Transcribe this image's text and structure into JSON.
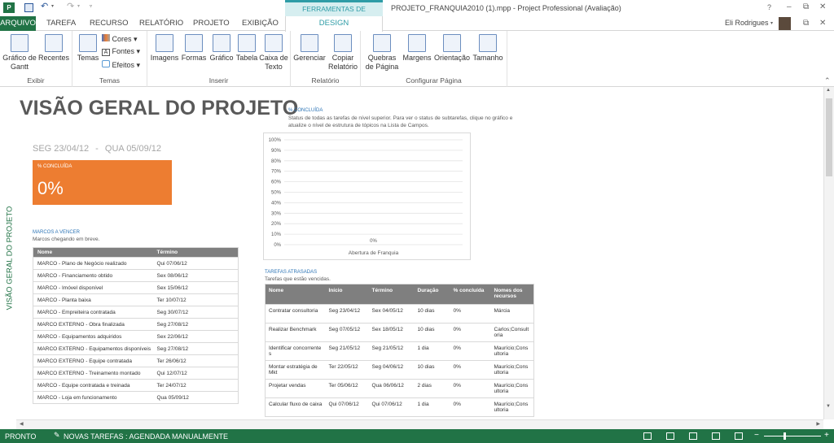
{
  "titlebar": {
    "context_tab": "FERRAMENTAS DE RELATÓRIO",
    "title": "PROJETO_FRANQUIA2010 (1).mpp - Project Professional (Avaliação)",
    "help": "?",
    "min": "–",
    "restore": "⧉",
    "close": "✕"
  },
  "tabs": [
    "ARQUIVO",
    "TAREFA",
    "RECURSO",
    "RELATÓRIO",
    "PROJETO",
    "EXIBIÇÃO",
    "DESIGN"
  ],
  "user": {
    "name": "Eli Rodrigues"
  },
  "ribbon": {
    "exibir": {
      "label": "Exibir",
      "gantt": "Gráfico de\nGantt",
      "recentes": "Recentes"
    },
    "temas": {
      "label": "Temas",
      "temas": "Temas",
      "cores": "Cores",
      "fontes": "Fontes",
      "efeitos": "Efeitos"
    },
    "inserir": {
      "label": "Inserir",
      "imagens": "Imagens",
      "formas": "Formas",
      "grafico": "Gráfico",
      "tabela": "Tabela",
      "caixa": "Caixa de\nTexto"
    },
    "relatorio": {
      "label": "Relatório",
      "gerenciar": "Gerenciar",
      "copiar": "Copiar\nRelatório"
    },
    "config": {
      "label": "Configurar Página",
      "quebras": "Quebras\nde Página",
      "margens": "Margens",
      "orientacao": "Orientação",
      "tamanho": "Tamanho"
    }
  },
  "report": {
    "side_label": "VISÃO GERAL DO PROJETO",
    "title": "VISÃO GERAL DO PROJETO",
    "date_start": "SEG 23/04/12",
    "date_end": "QUA 05/09/12",
    "pct_box": {
      "label": "% CONCLUÍDA",
      "value": "0%"
    },
    "milestones": {
      "title": "MARCOS A VENCER",
      "subtitle": "Marcos chegando em breve.",
      "headers": [
        "Nome",
        "Término"
      ],
      "rows": [
        [
          "MARCO - Plano de Negócio realizado",
          "Qui 07/06/12"
        ],
        [
          "MARCO - Financiamento obtido",
          "Sex 08/06/12"
        ],
        [
          "MARCO - Imóvel disponível",
          "Sex 15/06/12"
        ],
        [
          "MARCO - Planta baixa",
          "Ter 10/07/12"
        ],
        [
          "MARCO - Empreiteira contratada",
          "Seg 30/07/12"
        ],
        [
          "MARCO EXTERNO - Obra finalizada",
          "Seg 27/08/12"
        ],
        [
          "MARCO - Equipamentos adquiridos",
          "Sex 22/06/12"
        ],
        [
          "MARCO EXTERNO - Equipamentos disponíveis",
          "Seg 27/08/12"
        ],
        [
          "MARCO EXTERNO - Equipe contratada",
          "Ter 26/06/12"
        ],
        [
          "MARCO EXTERNO - Treinamento montado",
          "Qui 12/07/12"
        ],
        [
          "MARCO - Equipe contratada e treinada",
          "Ter 24/07/12"
        ],
        [
          "MARCO - Loja em funcionamento",
          "Qua 05/09/12"
        ]
      ]
    },
    "chart_section": {
      "title": "% CONCLUÍDA",
      "desc": "Status de todas as tarefas de nível superior. Para ver o status de subtarefas, clique no gráfico e atualize o nível de estrutura de tópicos na Lista de Campos."
    },
    "late": {
      "title": "TAREFAS ATRASADAS",
      "subtitle": "Tarefas que estão vencidas.",
      "headers": [
        "Nome",
        "Início",
        "Término",
        "Duração",
        "% concluída",
        "Nomes dos recursos"
      ],
      "rows": [
        [
          "Contratar consultoria",
          "Seg 23/04/12",
          "Sex 04/05/12",
          "10 dias",
          "0%",
          "Márcia"
        ],
        [
          "Realizar Benchmark",
          "Seg 07/05/12",
          "Sex 18/05/12",
          "10 dias",
          "0%",
          "Carlos;Consultoria"
        ],
        [
          "Identificar concorrentes",
          "Seg 21/05/12",
          "Seg 21/05/12",
          "1 dia",
          "0%",
          "Maurício;Consultoria"
        ],
        [
          "Montar estratégia de Mkt",
          "Ter 22/05/12",
          "Seg 04/06/12",
          "10 dias",
          "0%",
          "Maurício;Consultoria"
        ],
        [
          "Projetar vendas",
          "Ter 05/06/12",
          "Qua 06/06/12",
          "2 dias",
          "0%",
          "Maurício;Consultoria"
        ],
        [
          "Calcular fluxo de caixa",
          "Qui 07/06/12",
          "Qui 07/06/12",
          "1 dia",
          "0%",
          "Maurício;Consultoria"
        ]
      ]
    }
  },
  "chart_data": {
    "type": "bar",
    "categories": [
      "Abertura de Franquia"
    ],
    "values": [
      0
    ],
    "data_labels": [
      "0%"
    ],
    "yticks": [
      "100%",
      "90%",
      "80%",
      "70%",
      "60%",
      "50%",
      "40%",
      "30%",
      "20%",
      "10%",
      "0%"
    ],
    "ylim": [
      0,
      100
    ],
    "grid": true
  },
  "status": {
    "ready": "PRONTO",
    "mode": "NOVAS TAREFAS : AGENDADA MANUALMENTE"
  },
  "colors": {
    "accent_green": "#217346",
    "orange": "#ED7D31",
    "link_blue": "#2E75B6",
    "header_gray": "#7f7f7f",
    "context_teal": "#2E9CA6"
  }
}
